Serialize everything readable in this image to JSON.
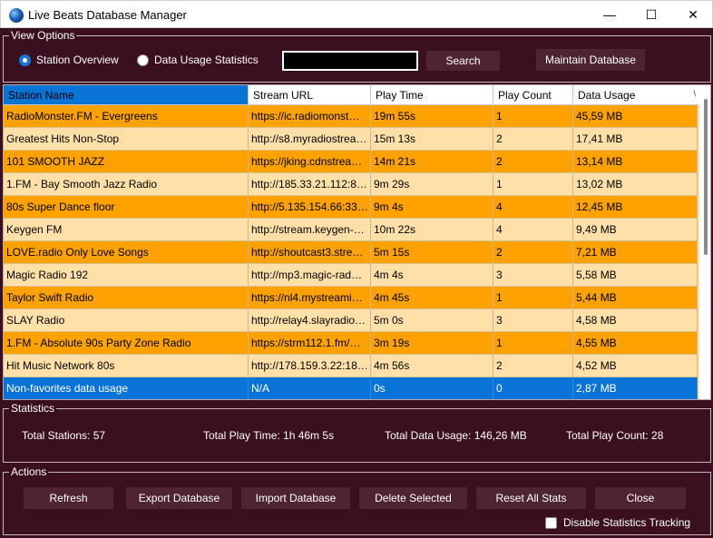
{
  "window": {
    "title": "Live Beats Database Manager",
    "minimize": "—",
    "maximize": "☐",
    "close": "✕"
  },
  "view_options": {
    "group_label": "View Options",
    "radio_station_overview": "Station Overview",
    "radio_data_usage": "Data Usage Statistics",
    "selected": "Station Overview",
    "search_value": "",
    "search_button": "Search",
    "maintain_button": "Maintain Database"
  },
  "table": {
    "columns": [
      "Station Name",
      "Stream URL",
      "Play Time",
      "Play Count",
      "Data Usage"
    ],
    "sort_glyph": "\\",
    "rows": [
      [
        "RadioMonster.FM - Evergreens",
        "https://ic.radiomonst…",
        "19m 55s",
        "1",
        "45,59 MB"
      ],
      [
        "Greatest Hits Non-Stop",
        "http://s8.myradiostrea…",
        "15m 13s",
        "2",
        "17,41 MB"
      ],
      [
        "101 SMOOTH JAZZ",
        "https://jking.cdnstrea…",
        "14m 21s",
        "2",
        "13,14 MB"
      ],
      [
        "1.FM - Bay Smooth Jazz Radio",
        "http://185.33.21.112:8…",
        "9m 29s",
        "1",
        "13,02 MB"
      ],
      [
        "80s  Super Dance floor",
        "http://5.135.154.66:33…",
        "9m 4s",
        "4",
        "12,45 MB"
      ],
      [
        "Keygen FM",
        "http://stream.keygen-…",
        "10m 22s",
        "4",
        "9,49 MB"
      ],
      [
        "LOVE.radio Only Love Songs",
        "http://shoutcast3.stre…",
        "5m 15s",
        "2",
        "7,21 MB"
      ],
      [
        "Magic Radio 192",
        "http://mp3.magic-rad…",
        "4m 4s",
        "3",
        "5,58 MB"
      ],
      [
        "Taylor Swift Radio",
        "https://nl4.mystreami…",
        "4m 45s",
        "1",
        "5,44 MB"
      ],
      [
        "SLAY Radio",
        "http://relay4.slayradio…",
        "5m 0s",
        "3",
        "4,58 MB"
      ],
      [
        "1.FM - Absolute 90s Party Zone Radio",
        "https://strm112.1.fm/…",
        "3m 19s",
        "1",
        "4,55 MB"
      ],
      [
        "Hit Music Network 80s",
        "http://178.159.3.22:18…",
        "4m 56s",
        "2",
        "4,52 MB"
      ],
      [
        "Non-favorites data usage",
        "N/A",
        "0s",
        "0",
        "2,87 MB"
      ]
    ],
    "selected_row_index": 12
  },
  "statistics": {
    "group_label": "Statistics",
    "total_stations": "Total Stations: 57",
    "total_play_time": "Total Play Time: 1h 46m 5s",
    "total_data_usage": "Total Data Usage: 146,26 MB",
    "total_play_count": "Total Play Count: 28"
  },
  "actions": {
    "group_label": "Actions",
    "refresh": "Refresh",
    "export": "Export Database",
    "import": "Import Database",
    "delete": "Delete Selected",
    "reset": "Reset All Stats",
    "close": "Close",
    "disable_tracking": "Disable Statistics Tracking",
    "disable_tracking_checked": false
  },
  "colors": {
    "background": "#3a0f1f",
    "row_orange": "#ffa200",
    "row_light": "#ffe0a8",
    "selection": "#0a74d6",
    "button": "#4e2432"
  }
}
